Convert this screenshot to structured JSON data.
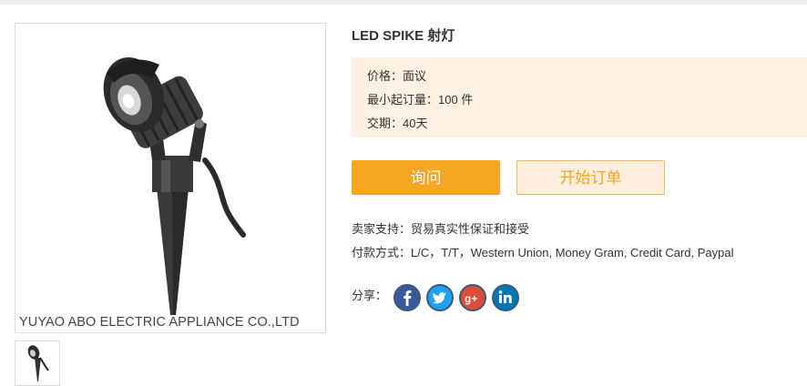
{
  "product": {
    "title": "LED SPIKE 射灯",
    "watermark": "YUYAO ABO ELECTRIC APPLIANCE CO.,LTD"
  },
  "details": {
    "price_label": "价格：",
    "price_value": "面议",
    "moq_label": "最小起订量：",
    "moq_value": "100 件",
    "delivery_label": "交期：",
    "delivery_value": "40天"
  },
  "buttons": {
    "inquire": "询问",
    "start_order": "开始订单"
  },
  "seller": {
    "support_label": "卖家支持：",
    "support_value": "贸易真实性保证和接受",
    "payment_label": "付款方式：",
    "payment_value": "L/C，T/T，Western Union, Money Gram, Credit Card, Paypal"
  },
  "share": {
    "label": "分享：",
    "networks": [
      {
        "name": "facebook",
        "icon": "facebook-icon",
        "color": "#3b5998"
      },
      {
        "name": "twitter",
        "icon": "twitter-icon",
        "color": "#1da1f2"
      },
      {
        "name": "google-plus",
        "icon": "google-plus-icon",
        "color": "#dd4b39"
      },
      {
        "name": "linkedin",
        "icon": "linkedin-icon",
        "color": "#0077b5"
      }
    ]
  },
  "colors": {
    "accent": "#f5a623",
    "price_bg": "#fdf1e4"
  }
}
